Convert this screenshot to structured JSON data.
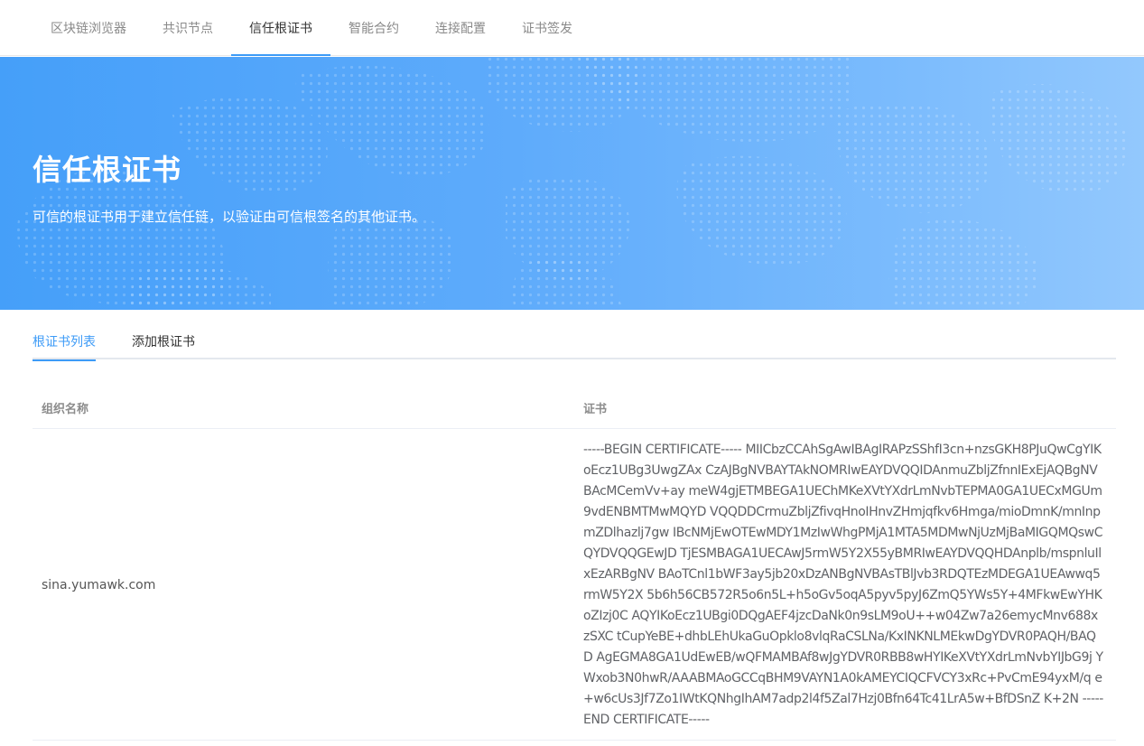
{
  "nav": {
    "tabs": [
      {
        "label": "区块链浏览器"
      },
      {
        "label": "共识节点"
      },
      {
        "label": "信任根证书"
      },
      {
        "label": "智能合约"
      },
      {
        "label": "连接配置"
      },
      {
        "label": "证书签发"
      }
    ],
    "active_index": 2
  },
  "banner": {
    "title": "信任根证书",
    "subtitle": "可信的根证书用于建立信任链，以验证由可信根签名的其他证书。"
  },
  "subtabs": {
    "items": [
      {
        "label": "根证书列表"
      },
      {
        "label": "添加根证书"
      }
    ],
    "active_index": 0
  },
  "table": {
    "headers": {
      "org_name": "组织名称",
      "certificate": "证书"
    },
    "rows": [
      {
        "org_name": "sina.yumawk.com",
        "certificate": "-----BEGIN CERTIFICATE----- MIICbzCCAhSgAwIBAgIRAPzSShfI3cn+nzsGKH8PJuQwCgYIKoEcz1UBg3UwgZAx CzAJBgNVBAYTAkNOMRIwEAYDVQQIDAnmuZbljZfnnIExEjAQBgNVBAcMCemVv+ay meW4gjETMBEGA1UEChMKeXVtYXdrLmNvbTEPMA0GA1UECxMGUm9vdENBMTMwMQYD VQQDDCrmuZbljZfivqHnoIHnvZHmjqfkv6Hmga/mioDmnK/mnInpmZDlhazlj7gw IBcNMjEwOTEwMDY1MzIwWhgPMjA1MTA5MDMwNjUzMjBaMIGQMQswCQYDVQQGEwJD TjESMBAGA1UECAwJ5rmW5Y2X55yBMRIwEAYDVQQHDAnplb/mspnluIlxEzARBgNV BAoTCnl1bWF3ay5jb20xDzANBgNVBAsTBlJvb3RDQTEzMDEGA1UEAwwq5rmW5Y2X 5b6h56CB572R5o6n5L+h5oGv5oqA5pyv5pyJ6ZmQ5YWs5Y+4MFkwEwYHKoZIzj0C AQYIKoEcz1UBgi0DQgAEF4jzcDaNk0n9sLM9oU++w04Zw7a26emycMnv688xzSXC tCupYeBE+dhbLEhUkaGuOpklo8vlqRaCSLNa/KxINKNLMEkwDgYDVR0PAQH/BAQD AgEGMA8GA1UdEwEB/wQFMAMBAf8wJgYDVR0RBB8wHYIKeXVtYXdrLmNvbYIJbG9j YWxob3N0hwR/AAABMAoGCCqBHM9VAYN1A0kAMEYCIQCFVCY3xRc+PvCmE94yxM/q e+w6cUs3Jf7Zo1IWtKQNhgIhAM7adp2l4f5Zal7Hzj0Bfn64Tc41LrA5w+BfDSnZ K+2N -----END CERTIFICATE-----"
      }
    ]
  },
  "colors": {
    "accent": "#3d9bf7",
    "banner_start": "#459ff9",
    "banner_end": "#93c8fd"
  }
}
